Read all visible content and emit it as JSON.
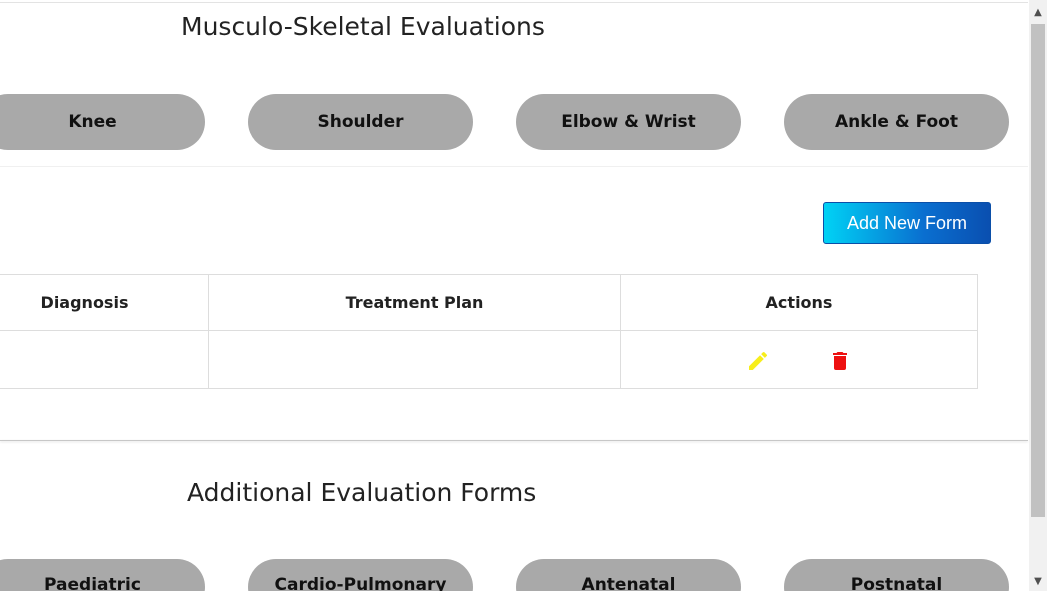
{
  "musculo_section": {
    "title": "Musculo-Skeletal Evaluations",
    "categories": [
      "Knee",
      "Shoulder",
      "Elbow & Wrist",
      "Ankle & Foot"
    ]
  },
  "toolbar": {
    "add_label": "Add New Form"
  },
  "table": {
    "headers": [
      "Diagnosis",
      "Treatment Plan",
      "Actions"
    ],
    "rows": [
      {
        "diagnosis": "",
        "treatment_plan": "",
        "actions": [
          "edit-icon",
          "trash-icon"
        ]
      }
    ]
  },
  "additional_section": {
    "title": "Additional Evaluation Forms",
    "categories": [
      "Paediatric",
      "Cardio-Pulmonary",
      "Antenatal",
      "Postnatal"
    ]
  },
  "colors": {
    "pill_bg": "#a9a9a9",
    "add_button_gradient_start": "#00d2f5",
    "add_button_gradient_end": "#0a4fb0",
    "edit_icon": "#f7ee1b",
    "delete_icon": "#ee1111"
  },
  "scrollbar": {
    "up_arrow": "▲",
    "down_arrow": "▼"
  }
}
